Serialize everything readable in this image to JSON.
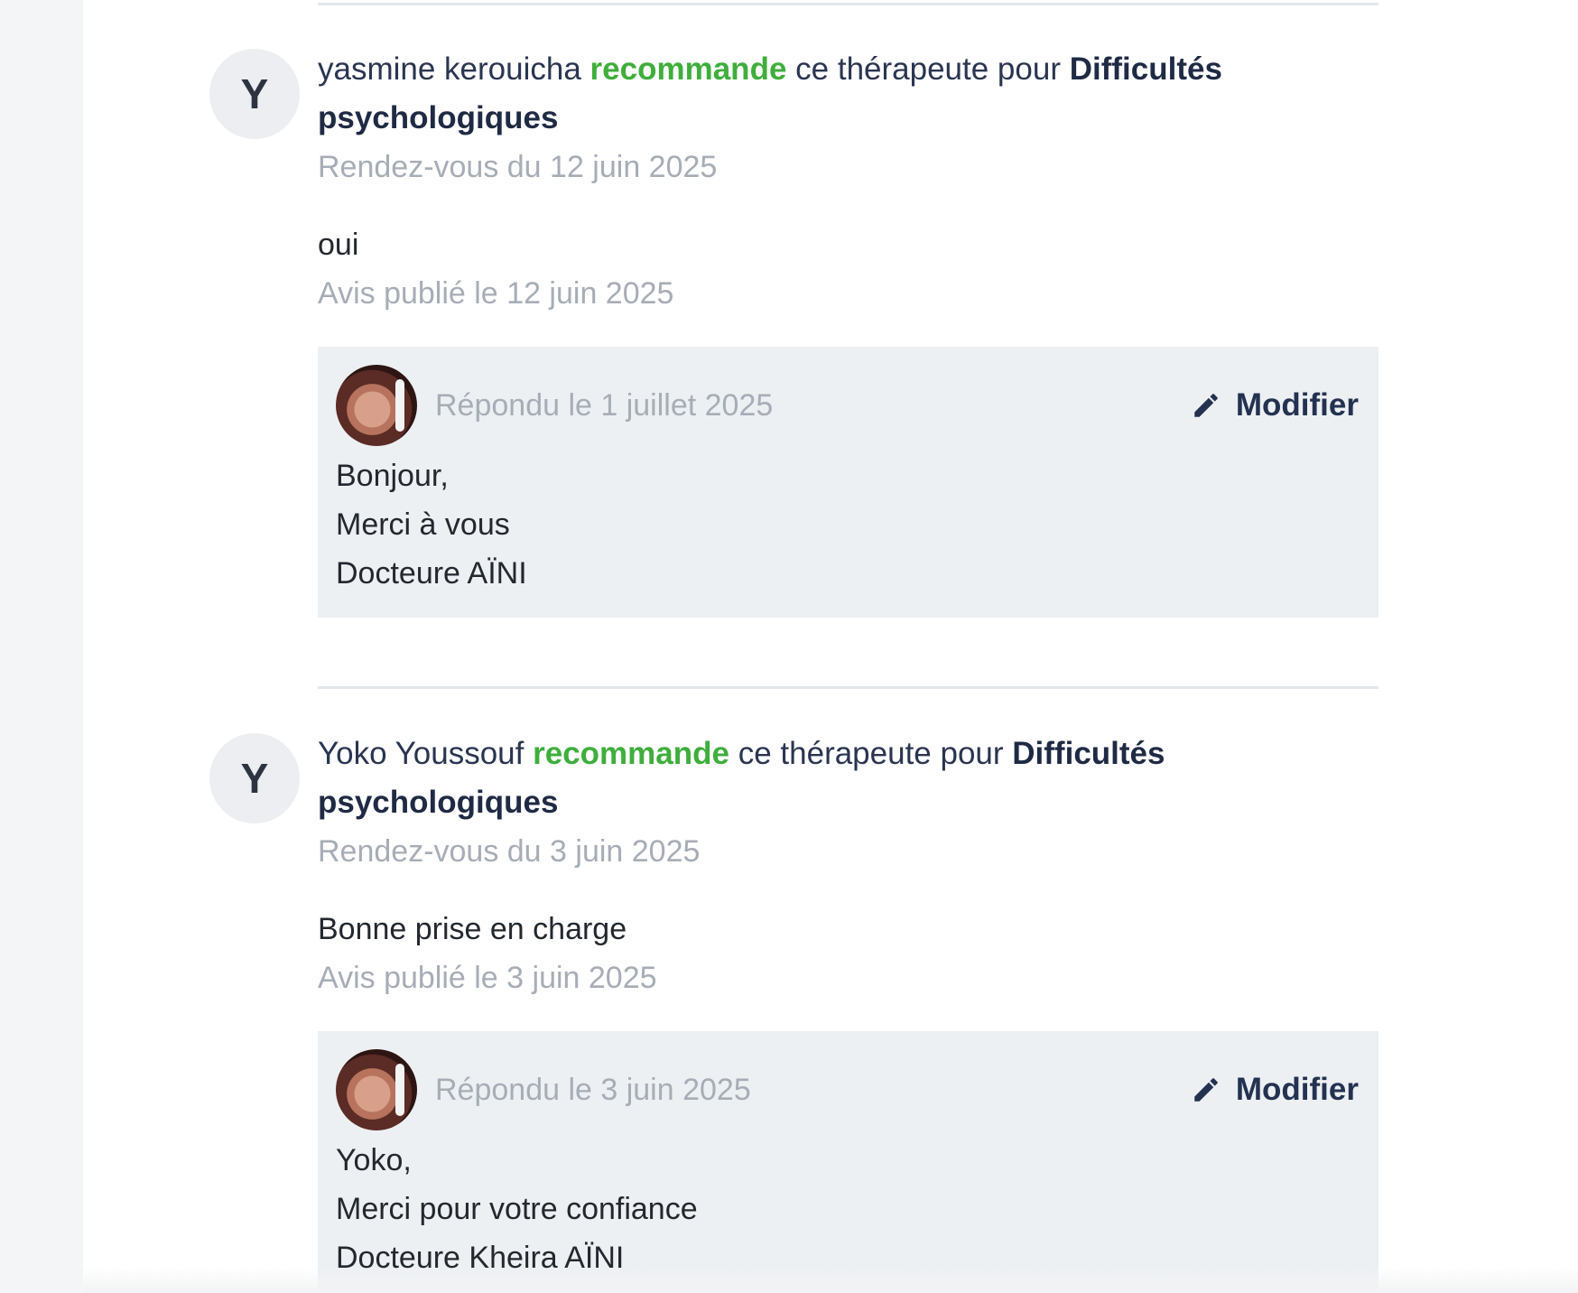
{
  "reviews": [
    {
      "avatar_letter": "Y",
      "author": "yasmine kerouicha",
      "recommend_word": "recommande",
      "middle_text": "ce thérapeute pour",
      "category": "Difficultés psychologiques",
      "appointment": "Rendez-vous du 12 juin 2025",
      "comment": "oui",
      "published": "Avis publié le 12 juin 2025",
      "reply": {
        "date": "Répondu le 1 juillet 2025",
        "modify_label": "Modifier",
        "lines": [
          "Bonjour,",
          "Merci à vous",
          "Docteure AÏNI"
        ]
      }
    },
    {
      "avatar_letter": "Y",
      "author": "Yoko Youssouf",
      "recommend_word": "recommande",
      "middle_text": "ce thérapeute pour",
      "category": "Difficultés psychologiques",
      "appointment": "Rendez-vous du 3 juin 2025",
      "comment": "Bonne prise en charge",
      "published": "Avis publié le 3 juin 2025",
      "reply": {
        "date": "Répondu le 3 juin 2025",
        "modify_label": "Modifier",
        "lines": [
          "Yoko,",
          "Merci pour votre confiance",
          "Docteure Kheira AÏNI"
        ]
      }
    }
  ],
  "colors": {
    "recommend_green": "#3fae3c",
    "navy": "#1f2a44",
    "meta_gray": "#a7adb6",
    "reply_bg": "#edf0f3"
  },
  "icons": {
    "modify": "pencil-icon",
    "therapist": "therapist-photo"
  }
}
